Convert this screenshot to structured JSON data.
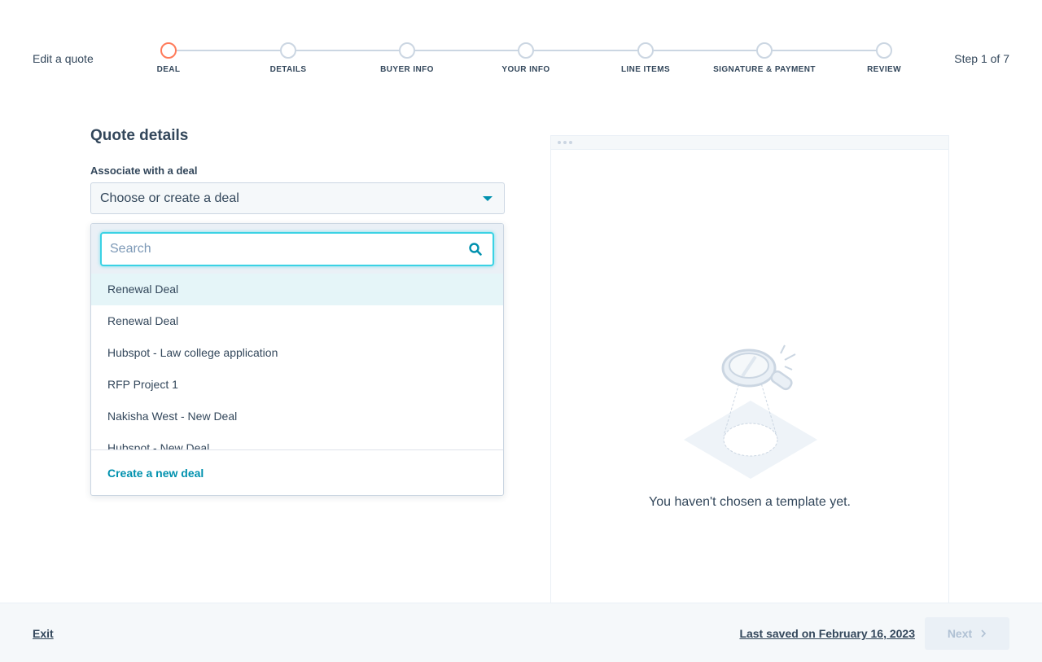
{
  "header": {
    "title": "Edit a quote",
    "step_count": "Step 1 of 7",
    "steps": [
      {
        "label": "DEAL",
        "active": true
      },
      {
        "label": "DETAILS",
        "active": false
      },
      {
        "label": "BUYER INFO",
        "active": false
      },
      {
        "label": "YOUR INFO",
        "active": false
      },
      {
        "label": "LINE ITEMS",
        "active": false
      },
      {
        "label": "SIGNATURE & PAYMENT",
        "active": false
      },
      {
        "label": "REVIEW",
        "active": false
      }
    ]
  },
  "form": {
    "section_title": "Quote details",
    "deal_label": "Associate with a deal",
    "deal_select_value": "Choose or create a deal",
    "dropdown": {
      "search_placeholder": "Search",
      "search_value": "",
      "items": [
        "Renewal Deal",
        "Renewal Deal",
        "Hubspot - Law college application",
        "RFP Project 1",
        "Nakisha West - New Deal",
        "Hubspot - New Deal"
      ],
      "hovered_index": 0,
      "create_label": "Create a new deal"
    }
  },
  "preview": {
    "empty_text": "You haven't chosen a template yet."
  },
  "footer": {
    "exit_label": "Exit",
    "last_saved": "Last saved on February 16, 2023",
    "next_label": "Next",
    "next_disabled": true
  },
  "colors": {
    "accent": "#0091ae",
    "active_step": "#ff7a59",
    "text": "#33475b",
    "border": "#cbd6e2",
    "hover": "#e5f5f8"
  }
}
